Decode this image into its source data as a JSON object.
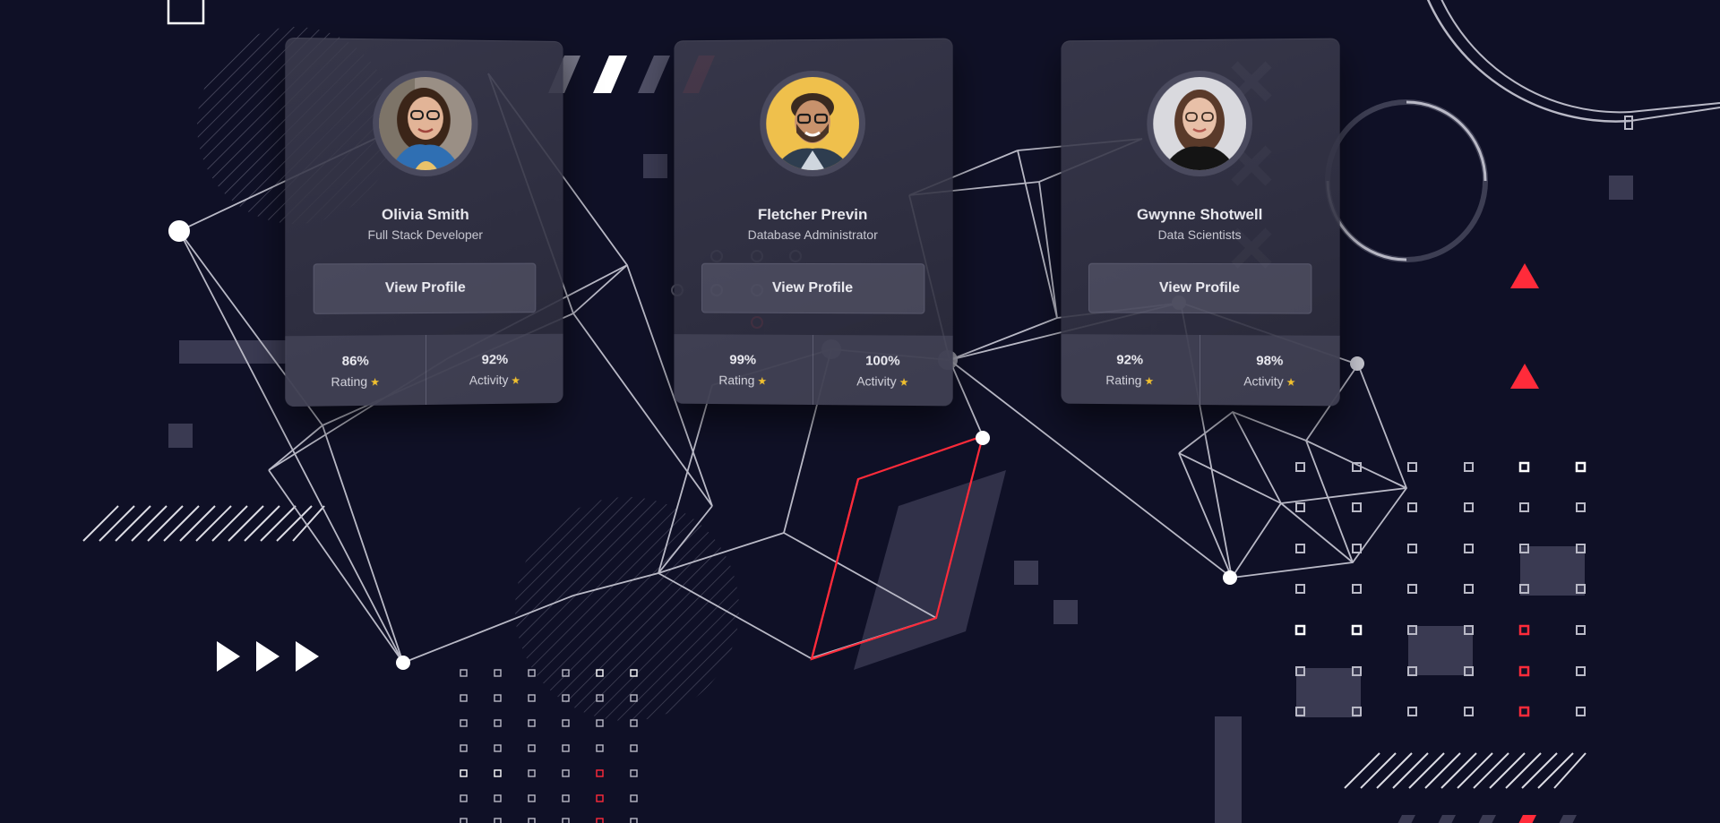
{
  "cards": [
    {
      "name": "Olivia Smith",
      "role": "Full Stack Developer",
      "button_label": "View Profile",
      "stats": [
        {
          "value": "86%",
          "label": "Rating"
        },
        {
          "value": "92%",
          "label": "Activity"
        }
      ],
      "avatar_bg": "#9a8f85"
    },
    {
      "name": "Fletcher Previn",
      "role": "Database Administrator",
      "button_label": "View Profile",
      "stats": [
        {
          "value": "99%",
          "label": "Rating"
        },
        {
          "value": "100%",
          "label": "Activity"
        }
      ],
      "avatar_bg": "#efc04c"
    },
    {
      "name": "Gwynne Shotwell",
      "role": "Data Scientists",
      "button_label": "View Profile",
      "stats": [
        {
          "value": "92%",
          "label": "Rating"
        },
        {
          "value": "98%",
          "label": "Activity"
        }
      ],
      "avatar_bg": "#d9d9de"
    }
  ],
  "icons": {
    "star": "star-icon"
  },
  "colors": {
    "background": "#0f1026",
    "accent_red": "#ff2b3a",
    "star": "#f2c12e",
    "line": "#b9b9c6"
  }
}
